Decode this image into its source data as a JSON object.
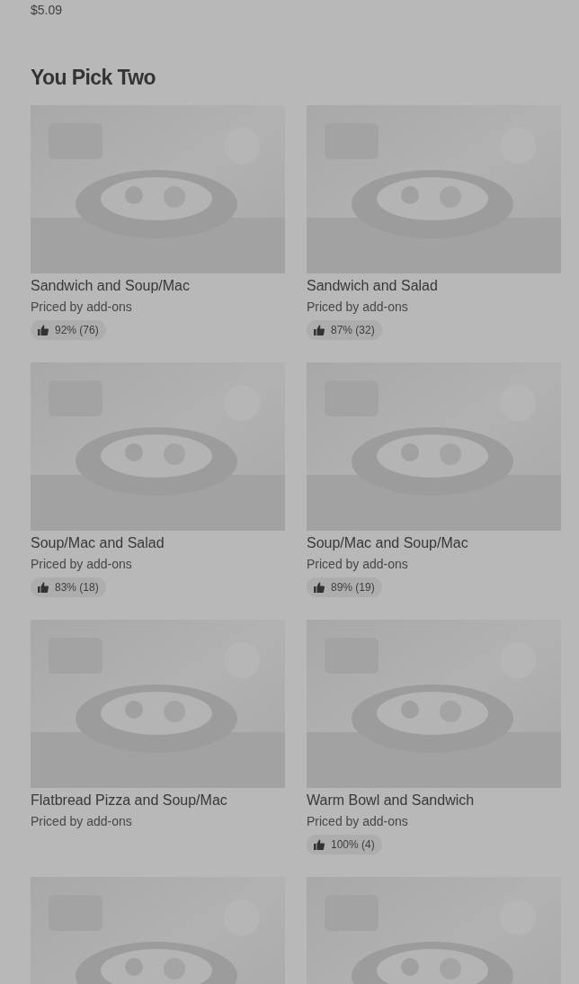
{
  "previous_item": {
    "price": "$5.09"
  },
  "section": {
    "title": "You Pick Two",
    "items": [
      {
        "image": {
          "kind": "picture"
        },
        "title": "Sandwich and Soup/Mac",
        "subtitle": "Priced by add-ons",
        "rating": "92% (76)"
      },
      {
        "image": {
          "kind": "picture"
        },
        "title": "Sandwich and Salad",
        "subtitle": "Priced by add-ons",
        "rating": "87% (32)"
      },
      {
        "image": {
          "kind": "picture"
        },
        "title": "Soup/Mac and Salad",
        "subtitle": "Priced by add-ons",
        "rating": "83% (18)"
      },
      {
        "image": {
          "kind": "picture"
        },
        "title": "Soup/Mac and Soup/Mac",
        "subtitle": "Priced by add-ons",
        "rating": "89% (19)"
      },
      {
        "image": {
          "kind": "picture"
        },
        "title": "Flatbread Pizza and Soup/Mac",
        "subtitle": "Priced by add-ons"
      },
      {
        "image": {
          "kind": "picture"
        },
        "title": "Warm Bowl and Sandwich",
        "subtitle": "Priced by add-ons",
        "rating": "100% (4)"
      },
      {
        "image": {
          "kind": "picture"
        }
      },
      {
        "image": {
          "kind": "picture"
        }
      }
    ]
  }
}
